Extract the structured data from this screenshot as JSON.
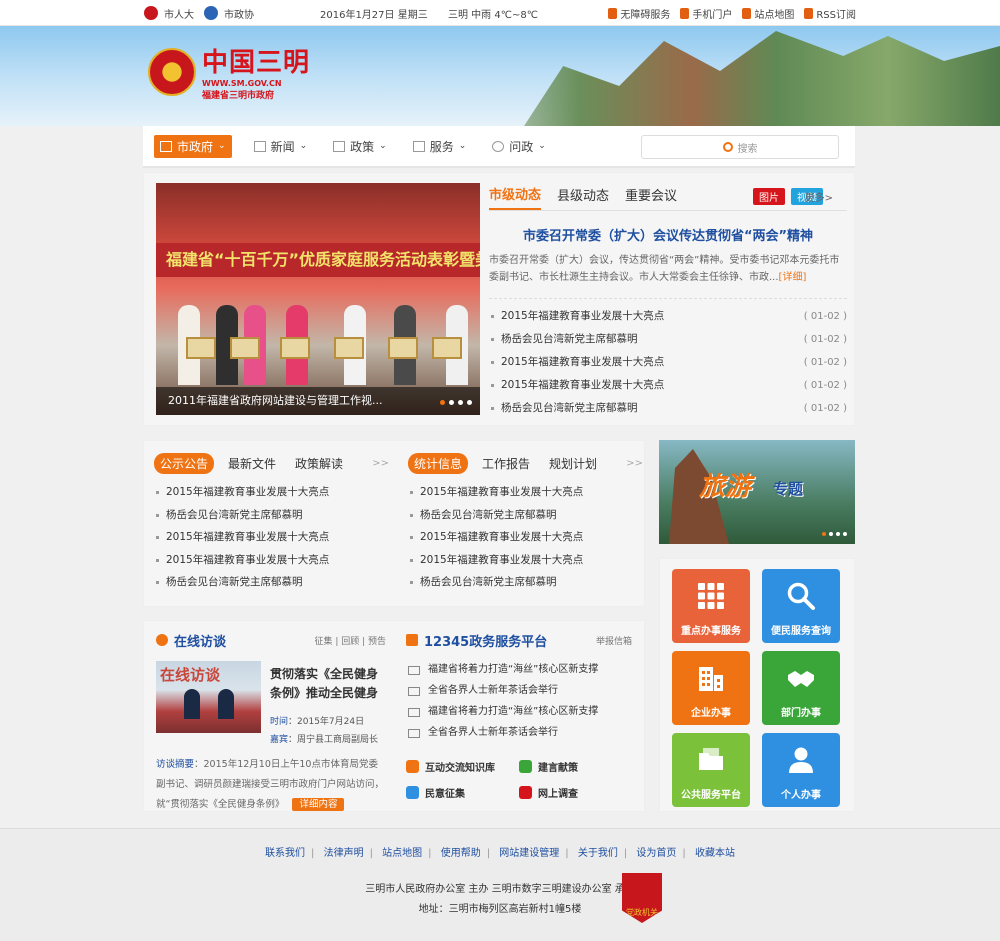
{
  "topbar": {
    "links_left": [
      "市人大",
      "市政协"
    ],
    "date": "2016年1月27日 星期三",
    "weather": "三明 中雨 4℃~8℃",
    "links_right": [
      "无障碍服务",
      "手机门户",
      "站点地图",
      "RSS订阅"
    ]
  },
  "header": {
    "title": "中国三明",
    "domain": "WWW.SM.GOV.CN",
    "subtitle": "福建省三明市政府"
  },
  "nav": {
    "items": [
      "市政府",
      "新闻",
      "政策",
      "服务",
      "问政"
    ],
    "search_placeholder": "搜索"
  },
  "featured": {
    "slide_banner": "福建省“十百千万”优质家庭服务活动表彰暨美食街(",
    "slide_caption": "2011年福建省政府网站建设与管理工作视...",
    "tabs": [
      "市级动态",
      "县级动态",
      "重要会议"
    ],
    "badges": [
      "图片",
      "视频"
    ],
    "more": "更多>",
    "headline": "市委召开常委（扩大）会议传达贯彻省“两会”精神",
    "summary": "市委召开常委（扩大）会议，传达贯彻省“两会”精神。受市委书记邓本元委托市委副书记、市长杜源生主持会议。市人大常委会主任徐铮、市政...",
    "summary_more": "[详细]",
    "list": [
      {
        "title": "2015年福建教育事业发展十大亮点",
        "date": "( 01-02 )"
      },
      {
        "title": "杨岳会见台湾新党主席郁慕明",
        "date": "( 01-02 )"
      },
      {
        "title": "2015年福建教育事业发展十大亮点",
        "date": "( 01-02 )"
      },
      {
        "title": "2015年福建教育事业发展十大亮点",
        "date": "( 01-02 )"
      },
      {
        "title": "杨岳会见台湾新党主席郁慕明",
        "date": "( 01-02 )"
      }
    ]
  },
  "notices": {
    "tabs": [
      "公示公告",
      "最新文件",
      "政策解读"
    ],
    "more": ">>",
    "list": [
      "2015年福建教育事业发展十大亮点",
      "杨岳会见台湾新党主席郁慕明",
      "2015年福建教育事业发展十大亮点",
      "2015年福建教育事业发展十大亮点",
      "杨岳会见台湾新党主席郁慕明"
    ]
  },
  "stats": {
    "tabs": [
      "统计信息",
      "工作报告",
      "规划计划"
    ],
    "more": ">>",
    "list": [
      "2015年福建教育事业发展十大亮点",
      "杨岳会见台湾新党主席郁慕明",
      "2015年福建教育事业发展十大亮点",
      "2015年福建教育事业发展十大亮点",
      "杨岳会见台湾新党主席郁慕明"
    ]
  },
  "tourism": {
    "text": "旅游",
    "text2": "专题"
  },
  "services": {
    "tiles": [
      {
        "label": "重点办事服务",
        "color": "#e8633a",
        "icon": "grid-icon"
      },
      {
        "label": "便民服务查询",
        "color": "#2f8fe0",
        "icon": "search-icon"
      },
      {
        "label": "企业办事",
        "color": "#f07313",
        "icon": "building-icon"
      },
      {
        "label": "部门办事",
        "color": "#3aa63a",
        "icon": "handshake-icon"
      },
      {
        "label": "公共服务平台",
        "color": "#7cc13a",
        "icon": "folder-icon"
      },
      {
        "label": "个人办事",
        "color": "#2f8fe0",
        "icon": "person-icon"
      }
    ]
  },
  "interview": {
    "title": "在线访谈",
    "links": "征集 | 回顾 | 预告",
    "pic_banner": "在线访谈",
    "headline": "贯彻落实《全民健身条例》推动全民健身",
    "time_label": "时间",
    "time": "2015年7月24日",
    "guest_label": "嘉宾",
    "guest": "周宁县工商局副局长",
    "abstract_label": "访谈摘要",
    "abstract": "：2015年12月10日上午10点市体育局党委副书记、调研员颜建瑞接受三明市政府门户网站访问，就“贯彻落实《全民健身条例》",
    "button": "详细内容"
  },
  "hotline": {
    "title": "12345政务服务平台",
    "link": "举报信箱",
    "list": [
      "福建省将着力打造“海丝”核心区新支撑",
      "全省各界人士新年茶话会举行",
      "福建省将着力打造“海丝”核心区新支撑",
      "全省各界人士新年茶话会举行"
    ],
    "links": [
      {
        "label": "互动交流知识库",
        "color": "#f07313"
      },
      {
        "label": "建言献策",
        "color": "#3aa63a"
      },
      {
        "label": "民意征集",
        "color": "#2f8fe0"
      },
      {
        "label": "网上调查",
        "color": "#d6141b"
      }
    ]
  },
  "footer": {
    "links": [
      "联系我们",
      "法律声明",
      "站点地图",
      "使用帮助",
      "网站建设管理",
      "关于我们",
      "设为首页",
      "收藏本站"
    ],
    "line1": "三明市人民政府办公室 主办 三明市数字三明建设办公室 承办",
    "line2": "地址：三明市梅列区高岩新村1幢5楼",
    "badge": "党政机关"
  }
}
